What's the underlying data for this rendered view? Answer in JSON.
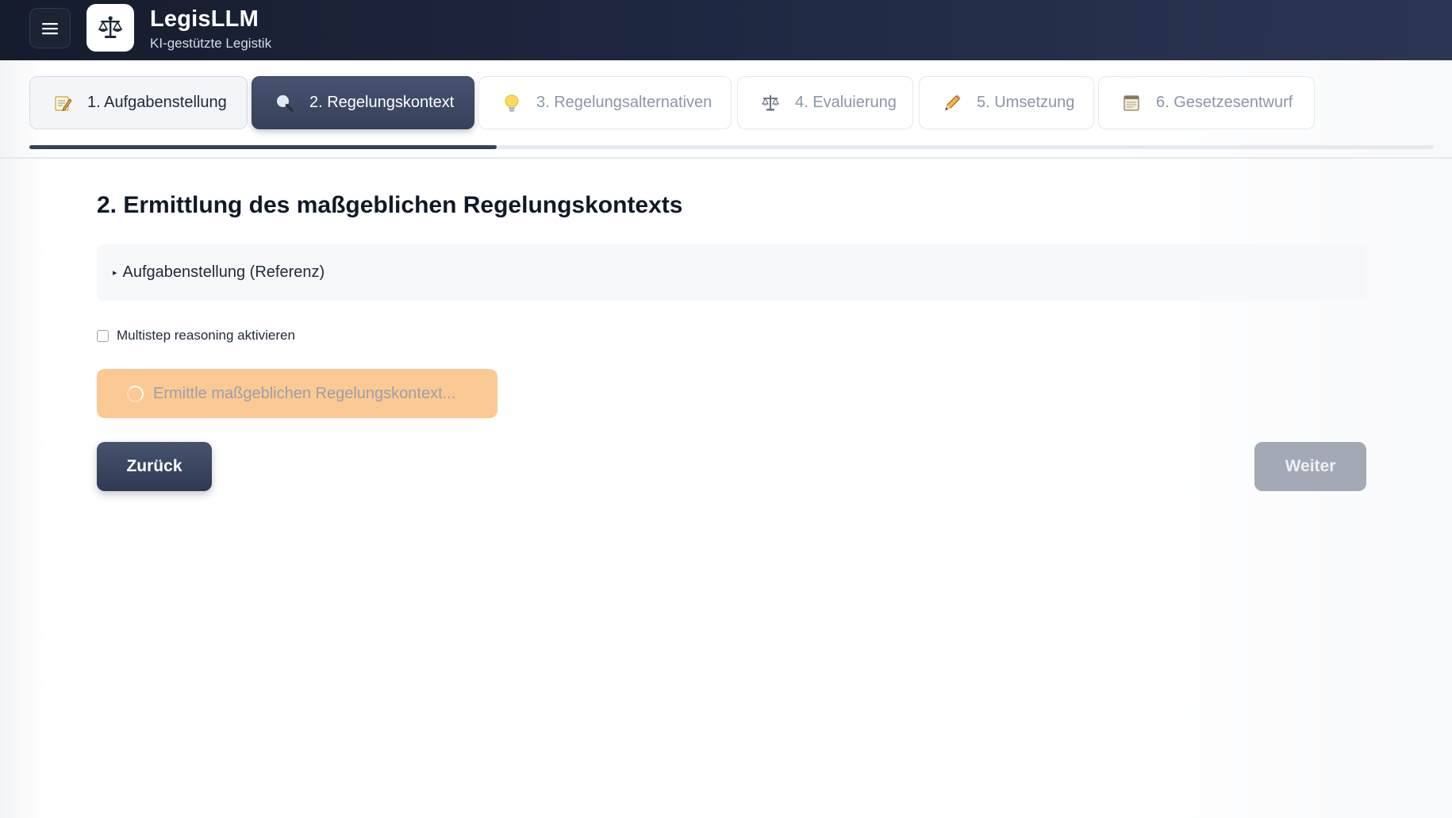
{
  "header": {
    "title": "LegisLLM",
    "subtitle": "KI-gestützte Legistik",
    "menu_icon": "hamburger-menu-icon",
    "logo_icon": "scales-of-justice-icon"
  },
  "tabs": [
    {
      "label": "1. Aufgabenstellung",
      "icon": "memo-icon",
      "state": "done"
    },
    {
      "label": "2. Regelungskontext",
      "icon": "magnifier-icon",
      "state": "active"
    },
    {
      "label": "3. Regelungsalternativen",
      "icon": "lightbulb-icon",
      "state": "pending"
    },
    {
      "label": "4. Evaluierung",
      "icon": "scales-icon",
      "state": "pending"
    },
    {
      "label": "5. Umsetzung",
      "icon": "pencil-icon",
      "state": "pending"
    },
    {
      "label": "6. Gesetzesentwurf",
      "icon": "document-icon",
      "state": "pending"
    }
  ],
  "progress": {
    "fraction": 0.333
  },
  "main": {
    "heading": "2. Ermittlung des maßgeblichen Regelungskontexts",
    "reference_summary": "Aufgabenstellung (Referenz)",
    "multistep_label": "Multistep reasoning aktivieren",
    "multistep_checked": false,
    "loading_label": "Ermittle maßgeblichen Regelungskontext...",
    "back_label": "Zurück",
    "next_label": "Weiter"
  },
  "colors": {
    "header_bg": "#1e2740",
    "active_tab": "#36415a",
    "loading_button": "#fbc993",
    "disabled_button": "#a3a9b5"
  }
}
